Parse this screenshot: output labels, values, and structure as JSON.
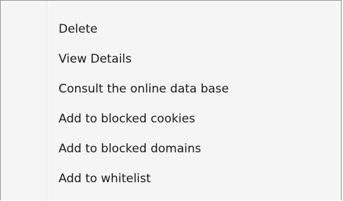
{
  "context_menu": {
    "items": [
      {
        "label": "Delete"
      },
      {
        "label": "View Details"
      },
      {
        "label": "Consult the online data base"
      },
      {
        "label": "Add to blocked cookies"
      },
      {
        "label": "Add to blocked domains"
      },
      {
        "label": "Add to whitelist"
      }
    ]
  }
}
